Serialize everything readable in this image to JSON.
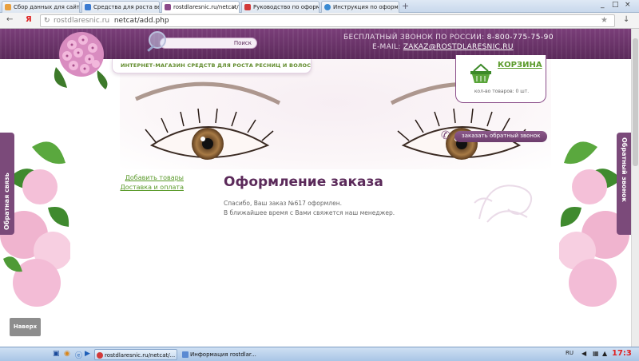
{
  "browser": {
    "tabs": [
      {
        "label": "Сбор данных для сайта",
        "color": "#e8a040"
      },
      {
        "label": "Средства для роста ве",
        "color": "#3b7bd1"
      },
      {
        "label": "rostdlaresnic.ru/netcat/a",
        "color": "#8b4a8a"
      },
      {
        "label": "Руководство по оформ",
        "color": "#d23a3a"
      },
      {
        "label": "Инструкция по оформ",
        "color": "#3a8ad2"
      }
    ],
    "new_tab_label": "+",
    "minimize": "_",
    "maximize": "□",
    "close": "×",
    "back": "←",
    "yandex_logo": "Я",
    "url_host": "rostdlaresnic.ru",
    "url_path": "netcat/add.php",
    "star": "★",
    "download": "↓"
  },
  "header": {
    "search_button": "Поиск",
    "phone_label": "БЕСПЛАТНЫЙ ЗВОНОК ПО РОССИИ:",
    "phone_number": "8-800-775-75-90",
    "email_label": "E-MAIL:",
    "email": "ZAKAZ@ROSTDLARESNIC.RU",
    "tagline": "ИНТЕРНЕТ-МАГАЗИН СРЕДСТВ ДЛЯ РОСТА РЕСНИЦ И ВОЛОС"
  },
  "cart": {
    "title": "КОРЗИНА",
    "count_text": "кол-во товаров: 0 шт."
  },
  "callback": {
    "label": "заказать обратный звонок"
  },
  "side_tabs": {
    "left": "Обратная связь",
    "right": "Обратный звонок"
  },
  "left_nav": [
    {
      "label": "Добавить товары"
    },
    {
      "label": "Доставка и оплата"
    }
  ],
  "main": {
    "title": "Оформление заказа",
    "line1": "Спасибо, Ваш заказ №617 оформлен.",
    "line2": "В ближайшее время с Вами свяжется наш менеджер."
  },
  "top_button": "Наверх",
  "taskbar": {
    "items": [
      {
        "label": "rostdlaresnic.ru/netcat/..."
      },
      {
        "label": "Информация rostdlar..."
      }
    ],
    "lang": "RU",
    "time": "17:3"
  },
  "colors": {
    "brand_purple": "#5b2a5a",
    "accent_green": "#5a9a2a"
  }
}
